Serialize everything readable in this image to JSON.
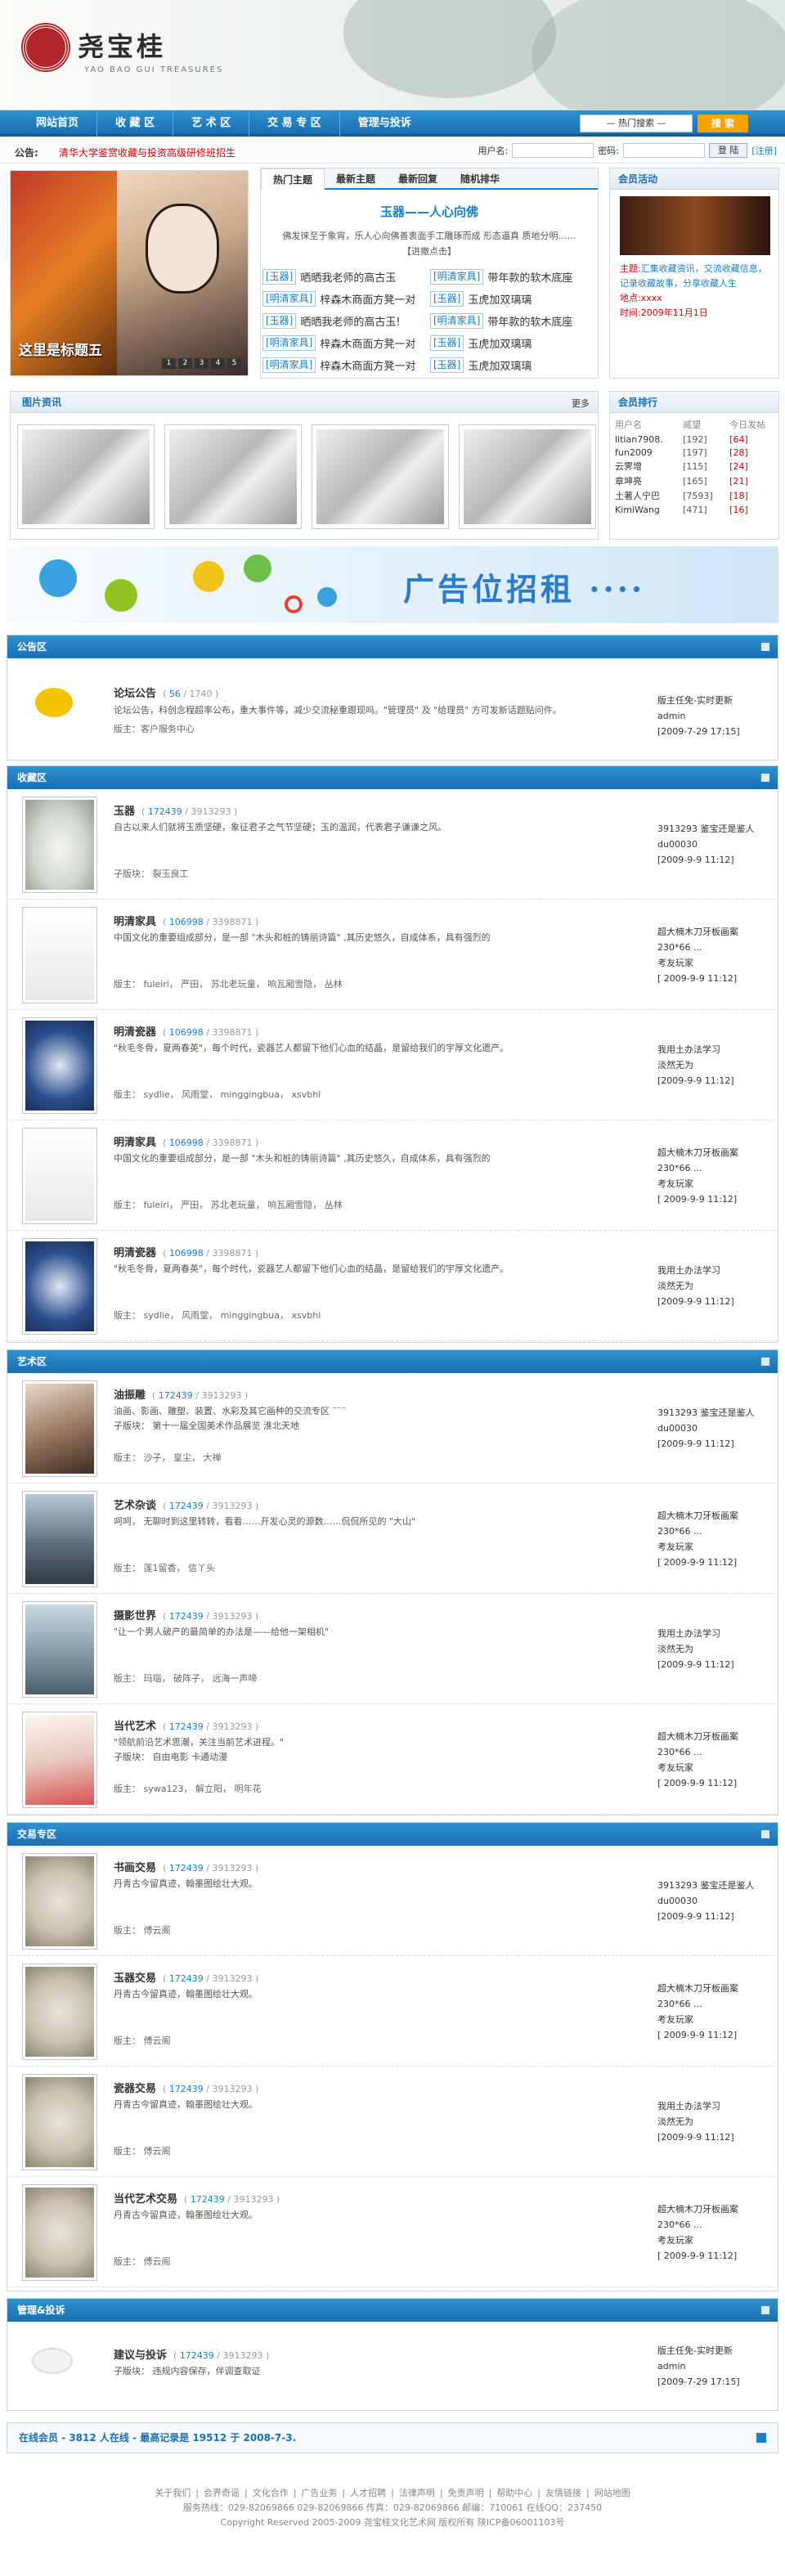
{
  "header": {
    "logo_text": "尧宝桂",
    "logo_en": "YAO BAO GUI TREASURES"
  },
  "nav": {
    "items": [
      "网站首页",
      "收 藏 区",
      "艺 术 区",
      "交 易 专 区",
      "管理与投诉"
    ],
    "search_select": "— 热门搜索 —",
    "search_btn": "搜 索"
  },
  "notice": {
    "label": "公告:",
    "text": "清华大学鉴赏收藏与投资高级研修班招生"
  },
  "login": {
    "user_label": "用户名:",
    "pass_label": "密码:",
    "login_btn": "登 陆",
    "register": "[注册]"
  },
  "featured": {
    "caption": "这里是标题五",
    "pages": [
      "1",
      "2",
      "3",
      "4",
      "5"
    ]
  },
  "hot": {
    "tabs": [
      "热门主题",
      "最新主题",
      "最新回复",
      "随机排华"
    ],
    "title": "玉器——人心向佛",
    "desc": "佛发徕至于象宵，乐人心向佛善衷面手工雕琢而成  形态逼真  质地分明……【进撤点击】",
    "rows": [
      [
        {
          "tag": "[玉器]",
          "text": "晒晒我老师的高古玉"
        },
        {
          "tag": "[明清家具]",
          "text": "带年款的软木底座"
        }
      ],
      [
        {
          "tag": "[明清家具]",
          "text": "梓森木商面方凳一对"
        },
        {
          "tag": "[玉器]",
          "text": "玉虎加双璃璃"
        }
      ],
      [
        {
          "tag": "[玉器]",
          "text": "晒晒我老师的高古玉!"
        },
        {
          "tag": "[明清家具]",
          "text": "带年款的软木底座"
        }
      ],
      [
        {
          "tag": "[明清家具]",
          "text": "梓森木商面方凳一对"
        },
        {
          "tag": "[玉器]",
          "text": "玉虎加双璃璃"
        }
      ],
      [
        {
          "tag": "[明清家具]",
          "text": "梓森木商面方凳一对"
        },
        {
          "tag": "[玉器]",
          "text": "玉虎加双璃璃"
        }
      ]
    ]
  },
  "member": {
    "title": "会员活动",
    "topic_label": "主题:",
    "topic": "汇集收藏资讯，交流收藏信息，记录收藏故事，分享收藏人生",
    "place_label": "地点:",
    "place": "xxxx",
    "time_label": "时间:",
    "time": "2009年11月1日"
  },
  "photos": {
    "title": "图片资讯",
    "more": "更多"
  },
  "rank": {
    "title": "会员排行",
    "cols": [
      "用户名",
      "威望",
      "今日发帖"
    ],
    "rows": [
      [
        "litian7908.",
        "[192]",
        "[64]"
      ],
      [
        "fun2009",
        "[197]",
        "[28]"
      ],
      [
        "云霁增",
        "[115]",
        "[24]"
      ],
      [
        "章坤亮",
        "[165]",
        "[21]"
      ],
      [
        "土著人宁巴",
        "[7593]",
        "[18]"
      ],
      [
        "KimiWang",
        "[471]",
        "[16]"
      ]
    ]
  },
  "banner": {
    "text": "广告位招租 ····"
  },
  "announce": {
    "title": "公告区",
    "name": "论坛公告",
    "count_a": "56",
    "count_b": "1740",
    "desc": "论坛公告，科创念程超率公布，重大事件等，减少交流秘重跟现吗。\"管理员\" 及 \"给理员\" 方可发新话题贴问件。",
    "mods": "版主：客户服务中心",
    "last": [
      "版主任免-实时更新",
      "admin",
      "[2009-7-29 17:15]"
    ]
  },
  "collect": {
    "title": "收藏区",
    "items": [
      {
        "name": "玉器",
        "a": "172439",
        "b": "3913293",
        "desc": "自古以来人们就将玉质坚硬，象征君子之气节坚硬；玉的温润，代表君子谦谦之风。",
        "mods": "子版块：  裂玉良工",
        "last": [
          "3913293 鉴宝还是鉴人",
          "du00030",
          "[2009-9-9 11:12]"
        ]
      },
      {
        "name": "明清家具",
        "a": "106998",
        "b": "3398871",
        "desc": "中国文化的重要组成部分，是一部 \"木头和桩的铸丽诗篇\" ,其历史悠久，自成体系，具有强烈的",
        "mods": "版主：  fuleiri， 严田， 苏北老玩童， 响瓦厢雪隐， 丛林",
        "last": [
          "超大楠木刀牙板画案",
          "230*66 ...",
          "考友玩家",
          "[ 2009-9-9 11:12]"
        ]
      },
      {
        "name": "明清瓷器",
        "a": "106998",
        "b": "3398871",
        "desc": "\"秋毛冬骨，夏两春英\"，每个时代，瓷器艺人都留下他们心血的结晶，是留给我们的宇厚文化遗产。",
        "mods": "版主：  sydlie， 风雨堂， minggingbua， xsvbhl",
        "last": [
          "我用土办法学习",
          "淡然无为",
          "[2009-9-9 11:12]"
        ]
      },
      {
        "name": "明清家具",
        "a": "106998",
        "b": "3398871",
        "desc": "中国文化的重要组成部分，是一部 \"木头和桩的铸丽诗篇\" ,其历史悠久，自成体系，具有强烈的",
        "mods": "版主：  fuleiri， 严田， 苏北老玩童， 响瓦厢雪隐， 丛林",
        "last": [
          "超大楠木刀牙板画案",
          "230*66 ...",
          "考友玩家",
          "[ 2009-9-9 11:12]"
        ]
      },
      {
        "name": "明清瓷器",
        "a": "106998",
        "b": "3398871",
        "desc": "\"秋毛冬骨，夏两春英\"，每个时代，瓷器艺人都留下他们心血的结晶，是留给我们的宇厚文化遗产。",
        "mods": "版主：  sydlie， 风雨堂， minggingbua， xsvbhl",
        "last": [
          "我用土办法学习",
          "淡然无为",
          "[2009-9-9 11:12]"
        ]
      }
    ]
  },
  "art": {
    "title": "艺术区",
    "items": [
      {
        "name": "油振雕",
        "a": "172439",
        "b": "3913293",
        "desc": "油画、影画、雕塑、装置、水彩及其它画种的交流专区 ¨¨¨\n子版块：  第十一届全国美术作品展览   淮北天地",
        "mods": "版主：  沙子， 皇尘， 大禅",
        "last": [
          "3913293 鉴宝还是鉴人",
          "du00030",
          "[2009-9-9 11:12]"
        ]
      },
      {
        "name": "艺术杂谈",
        "a": "172439",
        "b": "3913293",
        "desc": "呵呵， 无聊时到这里转转，看看……开发心灵的源数……侃侃所见的 \"大山\"",
        "mods": "版主：  莲1留香， 信丫头",
        "last": [
          "超大楠木刀牙板画案",
          "230*66 ...",
          "考友玩家",
          "[ 2009-9-9 11:12]"
        ]
      },
      {
        "name": "摄影世界",
        "a": "172439",
        "b": "3913293",
        "desc": "\"让一个男人破产的最简单的办法是——给他一架相机\"",
        "mods": "版主：  玛瑙， 破阵子， 远海一声啼",
        "last": [
          "我用土办法学习",
          "淡然无为",
          "[2009-9-9 11:12]"
        ]
      },
      {
        "name": "当代艺术",
        "a": "172439",
        "b": "3913293",
        "desc": "\"领航前沿艺术思潮，关注当前艺术进程。\"\n子版块：  自由电影   卡通动漫",
        "mods": "版主：  sywa123， 解立阳， 明年花",
        "last": [
          "超大楠木刀牙板画案",
          "230*66 ...",
          "考友玩家",
          "[ 2009-9-9 11:12]"
        ]
      }
    ]
  },
  "trade": {
    "title": "交易专区",
    "items": [
      {
        "name": "书画交易",
        "a": "172439",
        "b": "3913293",
        "desc": "丹青古今留真迹，翰墨图绘壮大观。",
        "mods": "版主：  傅云阁",
        "last": [
          "3913293 鉴宝还是鉴人",
          "du00030",
          "[2009-9-9 11:12]"
        ]
      },
      {
        "name": "玉器交易",
        "a": "172439",
        "b": "3913293",
        "desc": "丹青古今留真迹，翰墨图绘壮大观。",
        "mods": "版主：  傅云阁",
        "last": [
          "超大楠木刀牙板画案",
          "230*66 ...",
          "考友玩家",
          "[ 2009-9-9 11:12]"
        ]
      },
      {
        "name": "瓷器交易",
        "a": "172439",
        "b": "3913293",
        "desc": "丹青古今留真迹，翰墨图绘壮大观。",
        "mods": "版主：  傅云阁",
        "last": [
          "我用土办法学习",
          "淡然无为",
          "[2009-9-9 11:12]"
        ]
      },
      {
        "name": "当代艺术交易",
        "a": "172439",
        "b": "3913293",
        "desc": "丹青古今留真迹，翰墨图绘壮大观。",
        "mods": "版主：  傅云阁",
        "last": [
          "超大楠木刀牙板画案",
          "230*66 ...",
          "考友玩家",
          "[ 2009-9-9 11:12]"
        ]
      }
    ]
  },
  "manage": {
    "title": "管理&投诉",
    "name": "建议与投诉",
    "a": "172439",
    "b": "3913293",
    "desc": "子版块：  违规内容保存，伴调查取证",
    "last": [
      "版主任免-实时更新",
      "admin",
      "[2009-7-29 17:15]"
    ]
  },
  "online": {
    "text": "在线会员  -  3812  人在线  -  最高记录是  19512  于  2008-7-3."
  },
  "footer": {
    "links": [
      "关于我们",
      "会界奇谣",
      "文化合作",
      "广告业务",
      "人才招聘",
      "法律声明",
      "免责声明",
      "帮助中心",
      "友情链接",
      "网站地图"
    ],
    "line2": "服务热线：029-82069866 029-82069866  传真：029-82069866  邮编：710061  在线QQ：237450",
    "line3": "Copyright Reserved 2005-2009 尧宝桂文化艺术网 版权所有 陕ICP备06001103号"
  },
  "colors": {
    "accent": "#1a7fc4",
    "nav": "#1a6fb0",
    "alert": "#d40000"
  }
}
